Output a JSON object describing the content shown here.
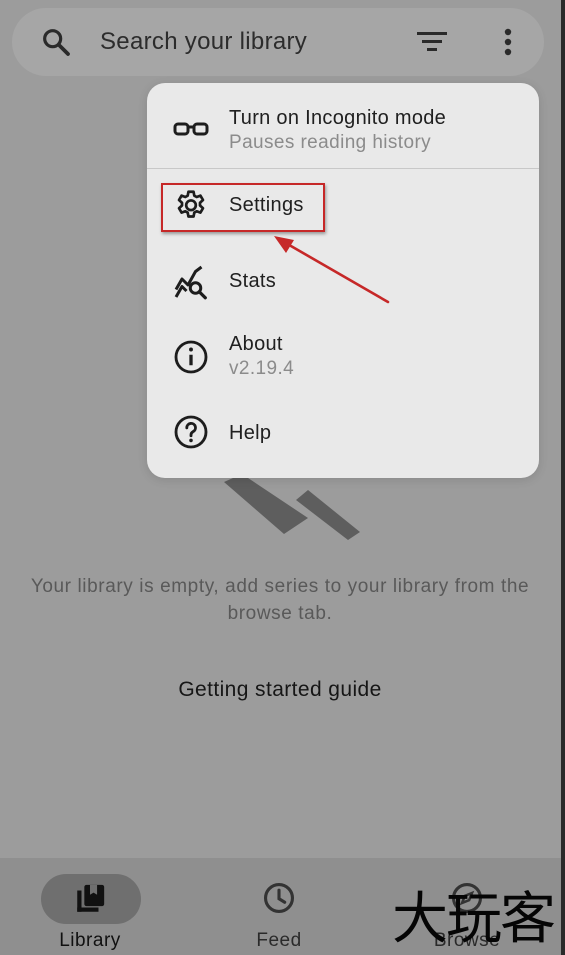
{
  "search": {
    "placeholder": "Search your library"
  },
  "icons": {
    "search": "search-icon",
    "filter": "filter-icon",
    "more": "more-vert-icon",
    "incognito": "glasses-icon",
    "settings": "gear-icon",
    "stats": "chart-search-icon",
    "about": "info-icon",
    "help": "help-circle-icon",
    "library": "bookmarks-icon",
    "feed": "clock-icon",
    "browse": "compass-icon"
  },
  "menu": {
    "incognito": {
      "title": "Turn on Incognito mode",
      "subtitle": "Pauses reading history"
    },
    "settings": {
      "title": "Settings"
    },
    "stats": {
      "title": "Stats"
    },
    "about": {
      "title": "About",
      "subtitle": "v2.19.4"
    },
    "help": {
      "title": "Help"
    }
  },
  "empty_state": {
    "message": "Your library is empty, add series to your library from the browse tab.",
    "guide_label": "Getting started guide"
  },
  "bottom_nav": {
    "items": [
      {
        "label": "Library",
        "active": true
      },
      {
        "label": "Feed",
        "active": false
      },
      {
        "label": "Browse",
        "active": false
      }
    ]
  },
  "watermark": {
    "text": "大玩客"
  },
  "colors": {
    "scrim": "#9c9c9c",
    "menu_bg": "#e9e9e9",
    "annotation": "#c62828",
    "active_pill": "#6f6f6f"
  }
}
